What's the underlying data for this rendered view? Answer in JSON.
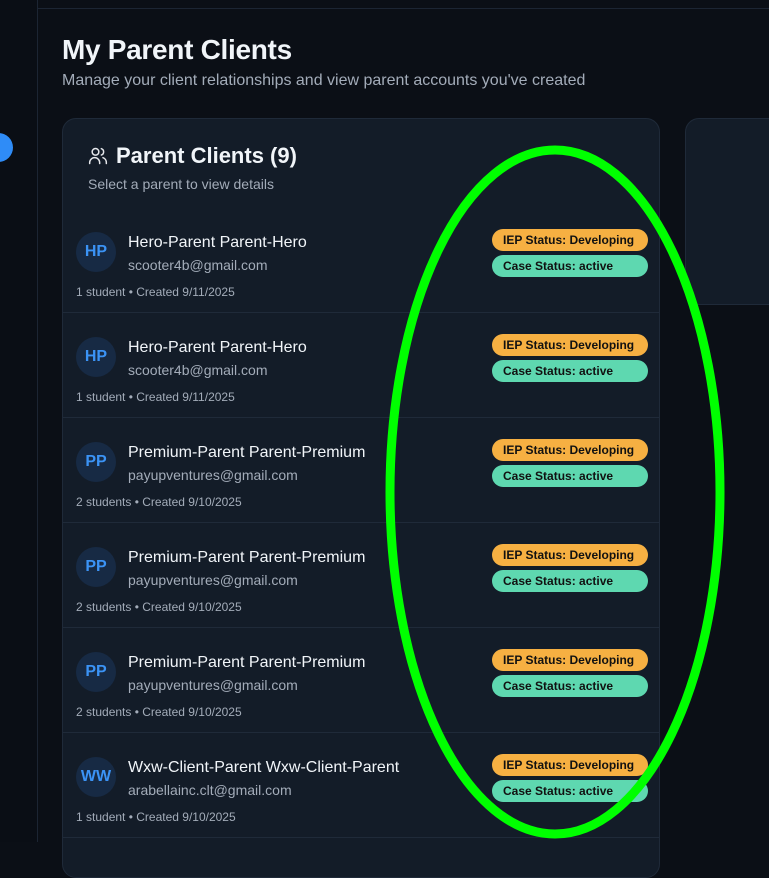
{
  "page": {
    "title": "My Parent Clients",
    "subtitle": "Manage your client relationships and view parent accounts you've created"
  },
  "card": {
    "title": "Parent Clients (9)",
    "subtitle": "Select a parent to view details",
    "icon": "users-icon"
  },
  "clients": [
    {
      "initials": "HP",
      "name": "Hero-Parent Parent-Hero",
      "email": "scooter4b@gmail.com",
      "meta": "1 student • Created 9/11/2025",
      "iep": "IEP Status: Developing",
      "case": "Case Status: active"
    },
    {
      "initials": "HP",
      "name": "Hero-Parent Parent-Hero",
      "email": "scooter4b@gmail.com",
      "meta": "1 student • Created 9/11/2025",
      "iep": "IEP Status: Developing",
      "case": "Case Status: active"
    },
    {
      "initials": "PP",
      "name": "Premium-Parent Parent-Premium",
      "email": "payupventures@gmail.com",
      "meta": "2 students • Created 9/10/2025",
      "iep": "IEP Status: Developing",
      "case": "Case Status: active"
    },
    {
      "initials": "PP",
      "name": "Premium-Parent Parent-Premium",
      "email": "payupventures@gmail.com",
      "meta": "2 students • Created 9/10/2025",
      "iep": "IEP Status: Developing",
      "case": "Case Status: active"
    },
    {
      "initials": "PP",
      "name": "Premium-Parent Parent-Premium",
      "email": "payupventures@gmail.com",
      "meta": "2 students • Created 9/10/2025",
      "iep": "IEP Status: Developing",
      "case": "Case Status: active"
    },
    {
      "initials": "WW",
      "name": "Wxw-Client-Parent Wxw-Client-Parent",
      "email": "arabellainc.clt@gmail.com",
      "meta": "1 student • Created 9/10/2025",
      "iep": "IEP Status: Developing",
      "case": "Case Status: active"
    }
  ],
  "colors": {
    "iep": "#f6b042",
    "case": "#5ed8b0",
    "accent": "#2f8cf7",
    "annotation": "#00ff00"
  }
}
